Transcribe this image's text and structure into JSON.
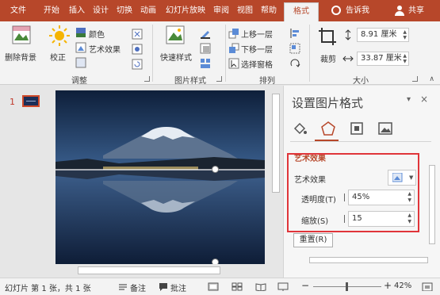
{
  "tabs": [
    {
      "label": "文件",
      "active": false
    },
    {
      "label": "开始",
      "active": false
    },
    {
      "label": "插入",
      "active": false
    },
    {
      "label": "设计",
      "active": false
    },
    {
      "label": "切换",
      "active": false
    },
    {
      "label": "动画",
      "active": false
    },
    {
      "label": "幻灯片放映",
      "active": false
    },
    {
      "label": "审阅",
      "active": false
    },
    {
      "label": "视图",
      "active": false
    },
    {
      "label": "帮助",
      "active": false
    },
    {
      "label": "格式",
      "active": true
    }
  ],
  "tell_me": "告诉我",
  "share": "共享",
  "ribbon": {
    "adjust": {
      "remove_bg": "删除背景",
      "correct": "校正",
      "color": "颜色",
      "artistic": "艺术效果",
      "group_label": "调整"
    },
    "picture_styles": {
      "quick_styles": "快速样式",
      "group_label": "图片样式"
    },
    "arrange": {
      "bring_forward": "上移一层",
      "send_backward": "下移一层",
      "selection_pane": "选择窗格",
      "group_label": "排列"
    },
    "size": {
      "crop": "裁剪",
      "height": "8.91 厘米",
      "width": "33.87 厘米",
      "group_label": "大小"
    }
  },
  "thumbnails": {
    "slide_number": "1"
  },
  "format_pane": {
    "title": "设置图片格式",
    "section_title": "艺术效果",
    "artistic_label": "艺术效果",
    "transparency_label": "透明度(T)",
    "transparency_value": "45%",
    "transparency_fraction": 0.45,
    "scale_label": "缩放(S)",
    "scale_value": "15",
    "reset_label": "重置(R)"
  },
  "status": {
    "slide_info": "幻灯片 第 1 张，共 1 张",
    "notes": "备注",
    "comments": "批注",
    "zoom": "42%"
  },
  "colors": {
    "brand": "#b7472a",
    "highlight_box": "#e0353a"
  }
}
